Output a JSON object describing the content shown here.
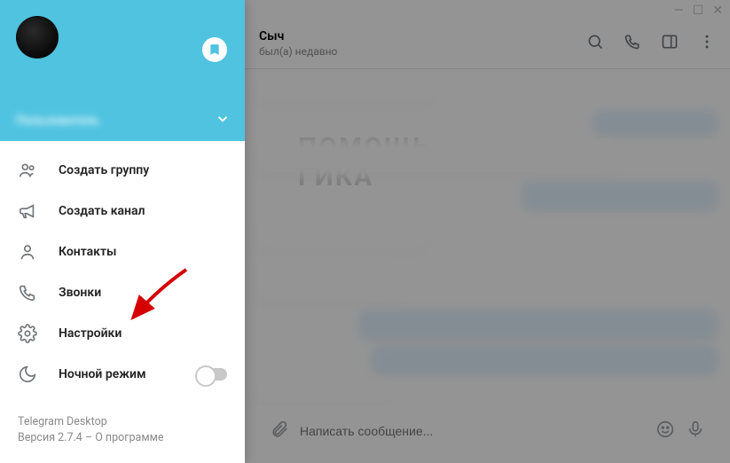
{
  "chat": {
    "title": "Сыч",
    "status": "был(а) недавно"
  },
  "sidebar": {
    "user_name": "Пользователь",
    "items": [
      {
        "label": "Создать группу"
      },
      {
        "label": "Создать канал"
      },
      {
        "label": "Контакты"
      },
      {
        "label": "Звонки"
      },
      {
        "label": "Настройки"
      },
      {
        "label": "Ночной режим"
      }
    ]
  },
  "footer": {
    "app_name": "Telegram Desktop",
    "version_line": "Версия 2.7.4 – О программе"
  },
  "compose": {
    "placeholder": "Написать сообщение..."
  },
  "watermark": {
    "line1": "ПОМОЩЬ",
    "line2": "ГИКА"
  }
}
